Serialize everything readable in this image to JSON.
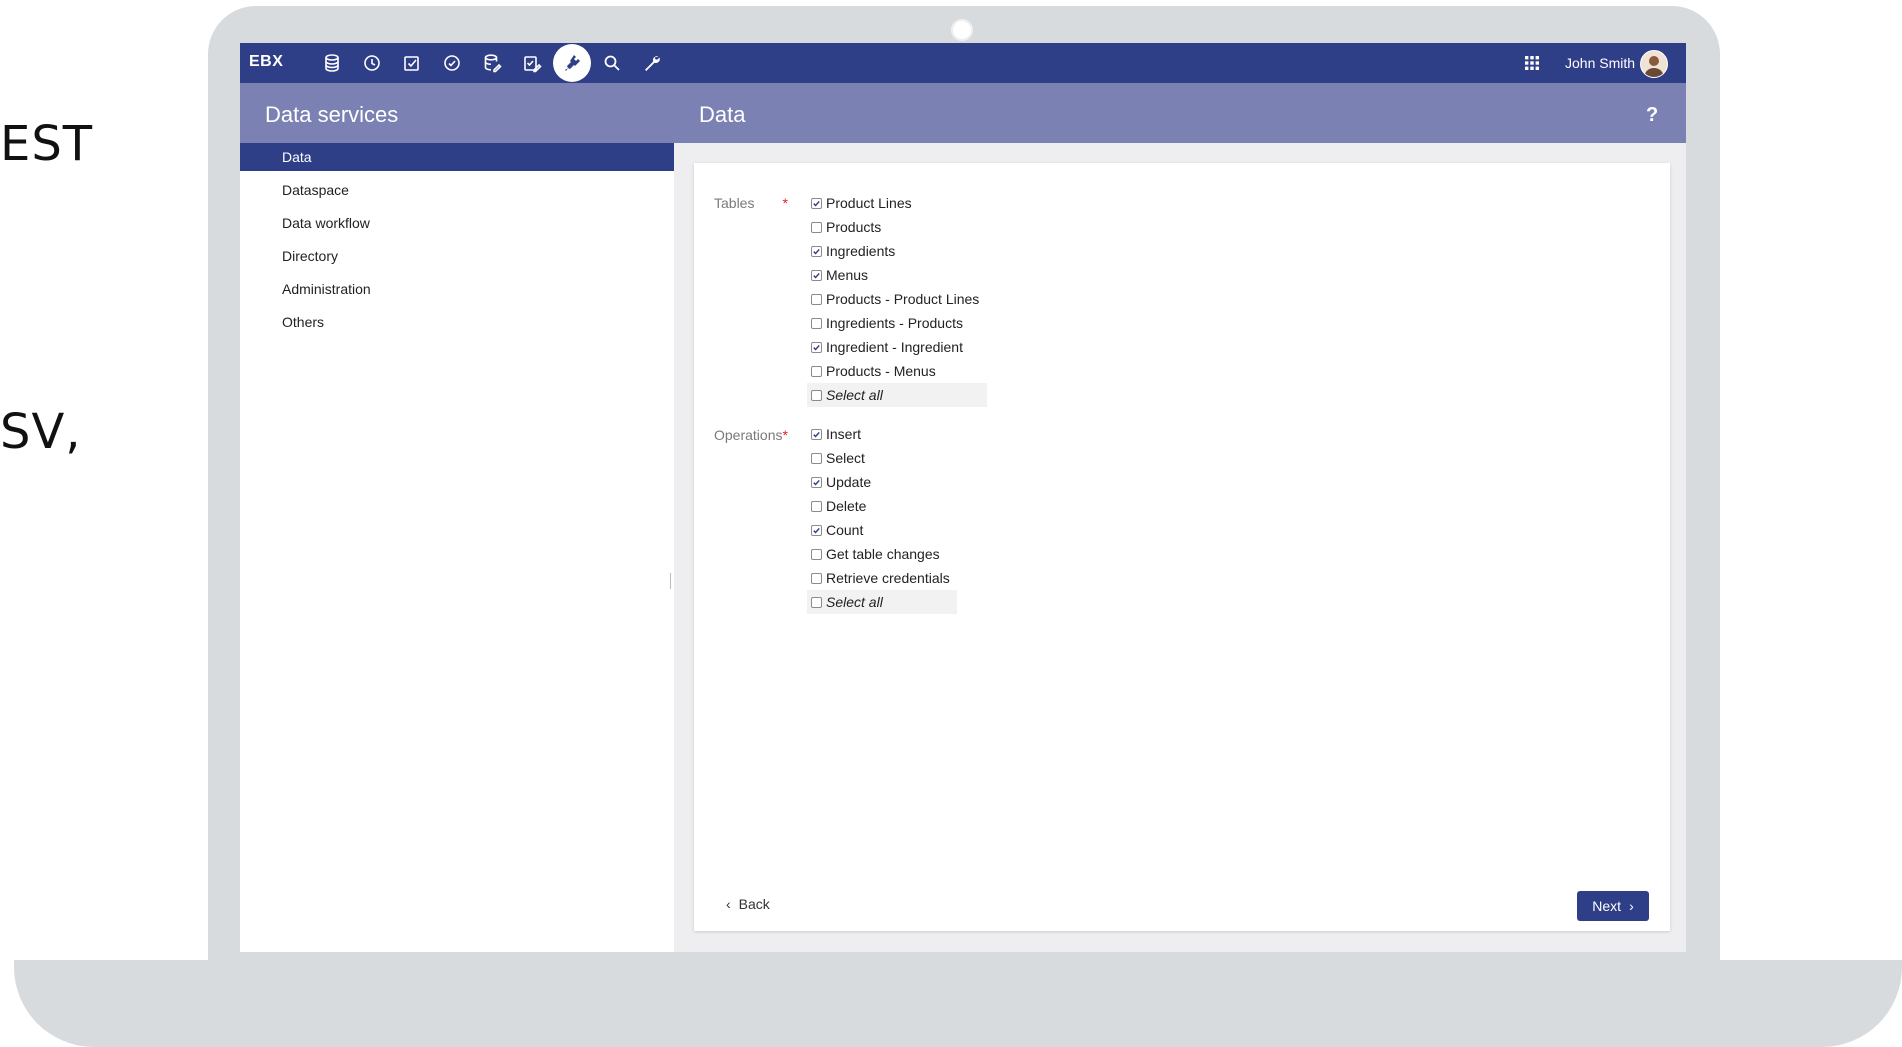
{
  "background_text": {
    "line1": "EST",
    "line2": "SV,"
  },
  "app": {
    "brand": "EBX",
    "user_name": "John Smith"
  },
  "toolbar_icons": [
    "database-icon",
    "clock-icon",
    "task-icon",
    "check-circle-icon",
    "database-edit-icon",
    "checklist-edit-icon",
    "plug-icon",
    "search-icon",
    "wrench-icon"
  ],
  "header": {
    "left_title": "Data services",
    "right_title": "Data",
    "help": "?"
  },
  "sidebar": {
    "items": [
      {
        "label": "Data",
        "active": true
      },
      {
        "label": "Dataspace",
        "active": false
      },
      {
        "label": "Data workflow",
        "active": false
      },
      {
        "label": "Directory",
        "active": false
      },
      {
        "label": "Administration",
        "active": false
      },
      {
        "label": "Others",
        "active": false
      }
    ]
  },
  "form": {
    "tables_label": "Tables",
    "required_mark": "*",
    "tables": [
      {
        "label": "Product Lines",
        "checked": true
      },
      {
        "label": "Products",
        "checked": false
      },
      {
        "label": "Ingredients",
        "checked": true
      },
      {
        "label": "Menus",
        "checked": true
      },
      {
        "label": "Products - Product Lines",
        "checked": false
      },
      {
        "label": "Ingredients - Products",
        "checked": false
      },
      {
        "label": "Ingredient - Ingredient",
        "checked": true
      },
      {
        "label": "Products - Menus",
        "checked": false
      },
      {
        "label": "Select all",
        "checked": false
      }
    ],
    "operations_label": "Operations",
    "operations": [
      {
        "label": "Insert",
        "checked": true
      },
      {
        "label": "Select",
        "checked": false
      },
      {
        "label": "Update",
        "checked": true
      },
      {
        "label": "Delete",
        "checked": false
      },
      {
        "label": "Count",
        "checked": true
      },
      {
        "label": "Get table changes",
        "checked": false
      },
      {
        "label": "Retrieve credentials",
        "checked": false
      },
      {
        "label": "Select all",
        "checked": false
      }
    ]
  },
  "footer": {
    "back_label": "Back",
    "next_label": "Next"
  },
  "colors": {
    "topbar": "#2e3e87",
    "subbar": "#7b82b3",
    "active_nav": "#2e3e87",
    "required": "#e02424"
  }
}
